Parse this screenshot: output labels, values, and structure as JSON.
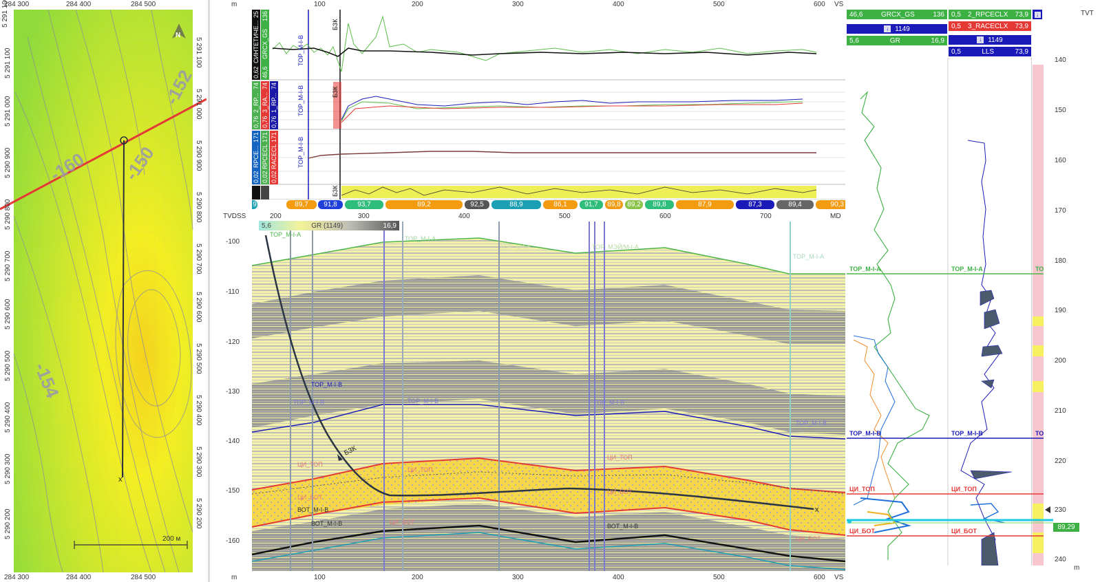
{
  "map": {
    "x_labels": [
      "284 300",
      "284 400",
      "284 500"
    ],
    "y_labels_left": [
      "5 291 100",
      "5 291 000",
      "5 290 900",
      "5 290 800",
      "5 290 700",
      "5 290 600",
      "5 290 500",
      "5 290 400",
      "5 290 300",
      "5 290 200"
    ],
    "y_labels_right": [
      "5 291 100",
      "5 291 000",
      "5 290 900",
      "5 290 800",
      "5 290 700",
      "5 290 600",
      "5 290 500",
      "5 290 400",
      "5 290 300",
      "5 290 200"
    ],
    "contours": [
      "-160",
      "-150",
      "-152",
      "-154"
    ],
    "scale_label": "200 м",
    "north_label": "N",
    "well_end_marker": "x"
  },
  "profile": {
    "unit_top": "m",
    "unit_bottom": "m",
    "vs_label": "VS",
    "vs_ticks": [
      "100",
      "200",
      "300",
      "400",
      "500",
      "600"
    ],
    "md_label": "MD",
    "md_ticks": [
      "200",
      "300",
      "400",
      "500",
      "600",
      "700"
    ],
    "tvdss_label": "TVDSS",
    "tvdss_ticks": [
      "-100",
      "-110",
      "-120",
      "-130",
      "-140",
      "-150",
      "-160"
    ]
  },
  "tracks": {
    "track1": [
      {
        "min": "0,62",
        "name": "СИНТЕТИЧЕ...",
        "max": "25",
        "color": "#111111"
      },
      {
        "min": "46,6",
        "name": "GRCX_GS",
        "max": "136",
        "color": "#3cb043"
      }
    ],
    "track2": [
      {
        "min": "0,76",
        "name": "2_RP...",
        "max": "74",
        "color": "#4caf50"
      },
      {
        "min": "0,76",
        "name": "3_RA...",
        "max": "74",
        "color": "#e53935"
      },
      {
        "min": "0,76",
        "name": "1_RP...",
        "max": "74",
        "color": "#1a1aa6"
      }
    ],
    "track3": [
      {
        "min": "0,02",
        "name": "RPCE...",
        "max": "171",
        "color": "#1565c0"
      },
      {
        "min": "0,02",
        "name": "RPCECL",
        "max": "171",
        "color": "#4caf50"
      },
      {
        "min": "0,02",
        "name": "RACECL",
        "max": "171",
        "color": "#e53935"
      }
    ],
    "track4": [
      {
        "min": "",
        "name": "",
        "max": "",
        "color": "#111111"
      },
      {
        "min": "",
        "name": "",
        "max": "",
        "color": "#444444"
      }
    ],
    "marker_top_m1b": "ТОР_М-І-В",
    "marker_bzk": "БЗК"
  },
  "dip_chips": [
    {
      "label": "9",
      "color": "#1a9fb3"
    },
    {
      "label": "89,7",
      "color": "#f39c12"
    },
    {
      "label": "91,8",
      "color": "#1e3fd9"
    },
    {
      "label": "93,7",
      "color": "#2ebd7a"
    },
    {
      "label": "89,2",
      "color": "#f39c12"
    },
    {
      "label": "92,5",
      "color": "#555555"
    },
    {
      "label": "88,9",
      "color": "#1a9fb3"
    },
    {
      "label": "86,1",
      "color": "#f39c12"
    },
    {
      "label": "91,7",
      "color": "#2ebd7a"
    },
    {
      "label": "89,8",
      "color": "#f39c12"
    },
    {
      "label": "89,2",
      "color": "#8bc34a"
    },
    {
      "label": "89,8",
      "color": "#2ebd7a"
    },
    {
      "label": "87,9",
      "color": "#f39c12"
    },
    {
      "label": "87,3",
      "color": "#1a1ab8"
    },
    {
      "label": "89,4",
      "color": "#666666"
    },
    {
      "label": "90,3",
      "color": "#f39c12"
    }
  ],
  "gr_legend": {
    "min": "5,6",
    "name": "GR (1149)",
    "max": "16,9"
  },
  "section_labels": {
    "top_m1a": "ТОР_М-І-А",
    "top_m1b": "ТОР_М-І-В",
    "ci_top": "ЦИ_ТОП",
    "ci_bot": "ЦИ_БОТ",
    "bot_m1b": "ВОТ_М-І-В",
    "bzk": "БЗК",
    "well_end": "x",
    "top_m1a_alt": "ТОР_МЭЙ/М-І-А"
  },
  "right_panel": {
    "tvt_label": "TVT",
    "tvt_unit": "m",
    "tvt_ticks": [
      "140",
      "150",
      "160",
      "170",
      "180",
      "190",
      "200",
      "210",
      "220",
      "230",
      "240"
    ],
    "col1": [
      {
        "min": "46,6",
        "name": "GRCX_GS",
        "max": "136",
        "color": "#3cb043"
      },
      {
        "min": "",
        "name": "1149",
        "max": "",
        "color": "#1a1ab8",
        "icon": true
      },
      {
        "min": "5,6",
        "name": "GR",
        "max": "16,9",
        "color": "#3cb043"
      }
    ],
    "col2": [
      {
        "min": "0,5",
        "name": "2_RPCECLX",
        "max": "73,9",
        "color": "#3cb043"
      },
      {
        "min": "0,5",
        "name": "3_RACECLX",
        "max": "73,9",
        "color": "#e53935"
      },
      {
        "min": "",
        "name": "1149",
        "max": "",
        "color": "#1a1ab8",
        "icon": true
      },
      {
        "min": "0,5",
        "name": "LLS",
        "max": "73,9",
        "color": "#1a1ab8"
      }
    ],
    "marker_top_m1a": "ТОР_М-І-А",
    "marker_top_m1a_b": "ТОР_М-І-А",
    "marker_top_m1b": "ТОР_М-І-В",
    "marker_top_m1b_b": "ТОР_М-І-В",
    "marker_ci_top": "ЦИ_ТОП",
    "marker_ci_bot": "ЦИ_БОТ",
    "marker_ci_top_b": "ЦИ_ТОП",
    "marker_ci_bot_b": "ЦИ_БОТ",
    "marker_to_short": "ТО",
    "marker_to_short2": "ТО",
    "dip_readout": "89,29"
  }
}
